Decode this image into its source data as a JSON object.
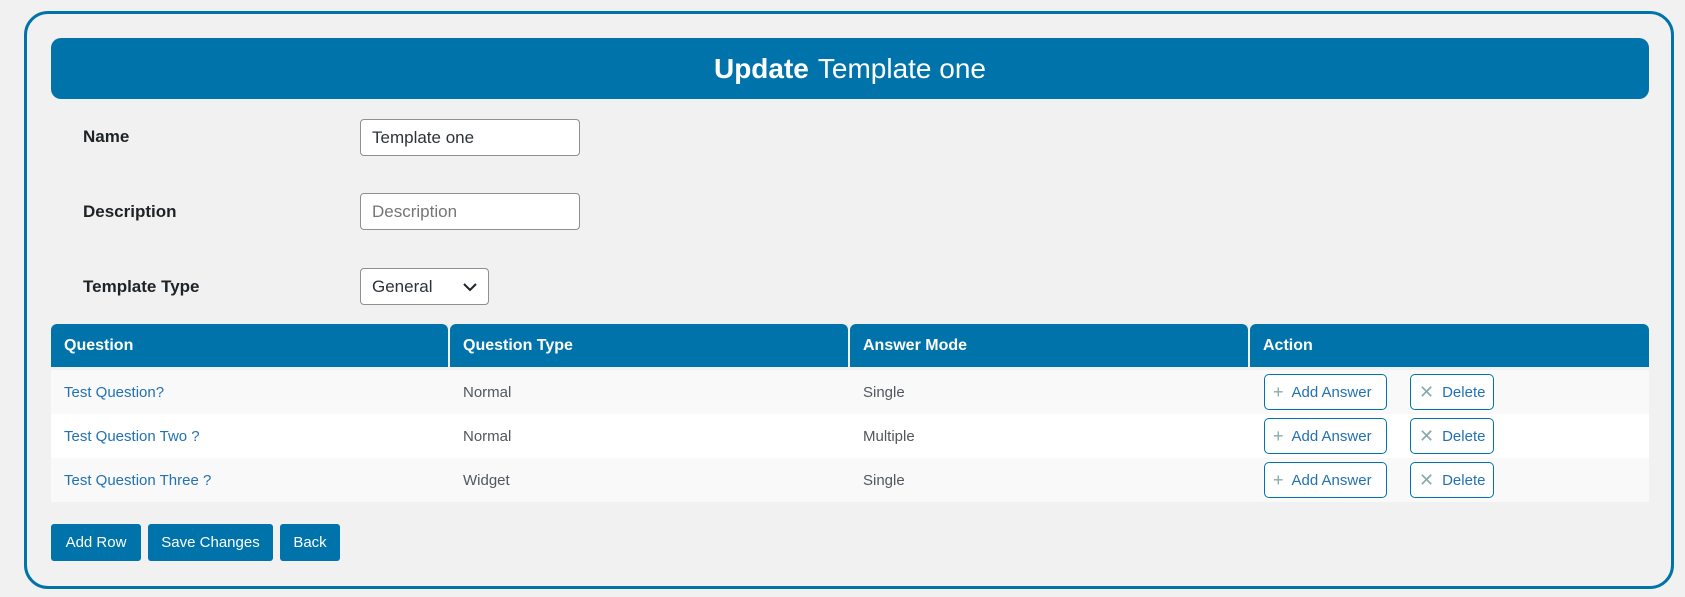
{
  "header": {
    "title_bold": "Update",
    "title_rest": "Template one"
  },
  "form": {
    "name_label": "Name",
    "name_value": "Template one",
    "description_label": "Description",
    "description_placeholder": "Description",
    "template_type_label": "Template Type",
    "template_type_value": "General"
  },
  "table": {
    "columns": [
      "Question",
      "Question Type",
      "Answer Mode",
      "Action"
    ],
    "rows": [
      {
        "question": "Test Question?",
        "type": "Normal",
        "mode": "Single"
      },
      {
        "question": "Test Question Two ?",
        "type": "Normal",
        "mode": "Multiple"
      },
      {
        "question": "Test Question Three ?",
        "type": "Widget",
        "mode": "Single"
      }
    ],
    "add_answer_label": "Add Answer",
    "delete_label": "Delete"
  },
  "buttons": {
    "add_row": "Add Row",
    "save": "Save Changes",
    "back": "Back"
  },
  "colors": {
    "accent": "#0073aa",
    "background": "#f1f1f1"
  }
}
